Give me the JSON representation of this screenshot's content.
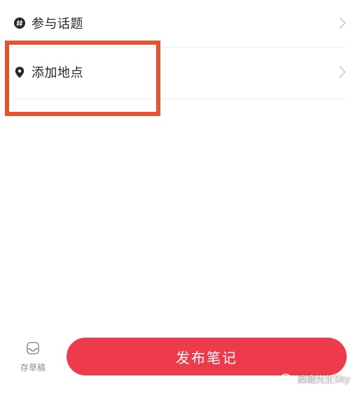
{
  "rows": {
    "topic": {
      "label": "参与话题",
      "icon": "hashtag-icon"
    },
    "location": {
      "label": "添加地点",
      "icon": "location-pin-icon"
    }
  },
  "draft": {
    "label": "存草稿",
    "icon": "draft-box-icon"
  },
  "publish": {
    "label": "发布笔记"
  },
  "watermark": {
    "text": "糜鹿先生Sky",
    "icon": "wechat-icon"
  },
  "colors": {
    "accent": "#ee3b4c",
    "highlight": "#e9522c",
    "text": "#262626",
    "muted": "#8e8e8e",
    "divider": "#ededed"
  }
}
